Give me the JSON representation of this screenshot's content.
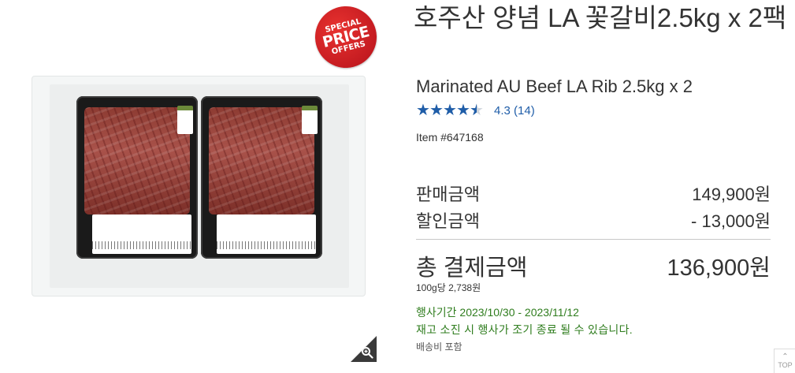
{
  "badge": {
    "line1": "SPECIAL",
    "line2": "PRICE",
    "line3": "OFFERS"
  },
  "product": {
    "title_ko": "호주산 양념 LA 꽃갈비2.5kg x 2팩",
    "title_en": "Marinated AU Beef LA Rib 2.5kg x 2",
    "rating": 4.3,
    "rating_text": "4.3 (14)",
    "item_number": "Item #647168"
  },
  "pricing": {
    "sell_label": "판매금액",
    "sell_value": "149,900원",
    "discount_label": "할인금액",
    "discount_value": "- 13,000원",
    "total_label": "총 결제금액",
    "total_value": "136,900원",
    "unit_price": "100g당 2,738원"
  },
  "promo": {
    "period": "행사기간 2023/10/30 - 2023/11/12",
    "note": "재고 소진 시 행사가 조기 종료 될 수 있습니다.",
    "shipping": "배송비 포함"
  },
  "top_button": {
    "label": "TOP"
  },
  "icons": {
    "zoom": "magnifier-zoom-icon",
    "star": "star-icon",
    "top": "chevron-up-icon"
  },
  "colors": {
    "rating_blue": "#1f5da8",
    "promo_green": "#2f7d1e",
    "badge_red": "#d0202a"
  }
}
